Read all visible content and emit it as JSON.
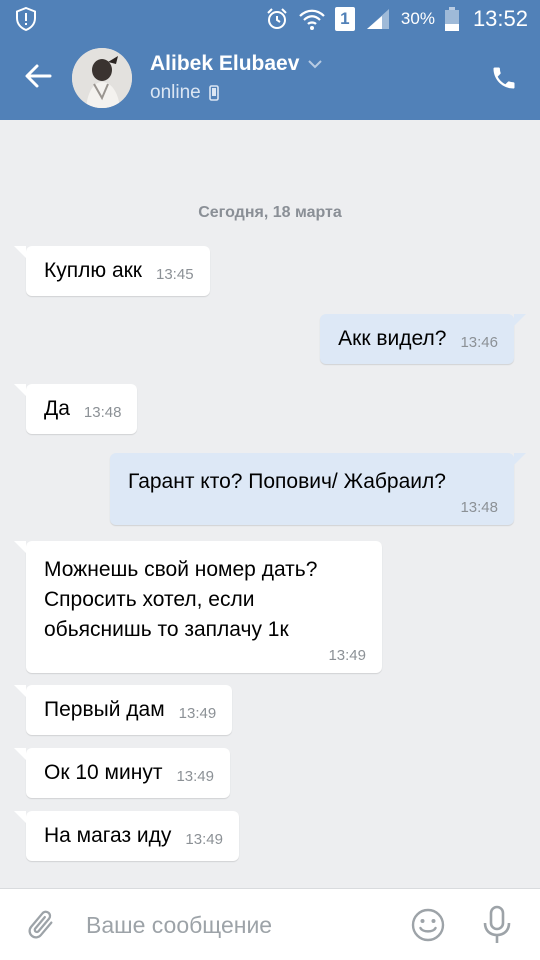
{
  "status_bar": {
    "battery": "30%",
    "time": "13:52",
    "sim_slot": "1"
  },
  "header": {
    "contact_name": "Alibek Elubaev",
    "contact_status": "online"
  },
  "chat": {
    "date_separator": "Сегодня, 18 марта",
    "messages": [
      {
        "direction": "in",
        "text": "Куплю акк",
        "time": "13:45"
      },
      {
        "direction": "out",
        "text": "Акк видел?",
        "time": "13:46"
      },
      {
        "direction": "in",
        "text": "Да",
        "time": "13:48"
      },
      {
        "direction": "out",
        "text": "Гарант кто? Попович/ Жабраил?",
        "time": "13:48"
      },
      {
        "direction": "in",
        "text": "Можнешь свой номер дать?\nСпросить хотел, если\nобьяснишь то заплачу 1к",
        "time": "13:49"
      },
      {
        "direction": "in",
        "text": "Первый дам",
        "time": "13:49"
      },
      {
        "direction": "in",
        "text": "Ок 10 минут",
        "time": "13:49"
      },
      {
        "direction": "in",
        "text": "На магаз иду",
        "time": "13:49"
      }
    ]
  },
  "composer": {
    "placeholder": "Ваше сообщение"
  },
  "colors": {
    "header_bg": "#5181b8",
    "chat_bg": "#edeef0",
    "incoming_bubble": "#ffffff",
    "outgoing_bubble": "#dde8f6"
  },
  "icons": {
    "status_left": "shield-alert-icon",
    "alarm": "alarm-clock-icon",
    "wifi": "wifi-icon",
    "signal": "cell-signal-icon",
    "battery": "battery-icon",
    "back": "arrow-left-icon",
    "call": "phone-icon",
    "attach": "paperclip-icon",
    "emoji": "smiley-icon",
    "mic": "microphone-icon"
  }
}
